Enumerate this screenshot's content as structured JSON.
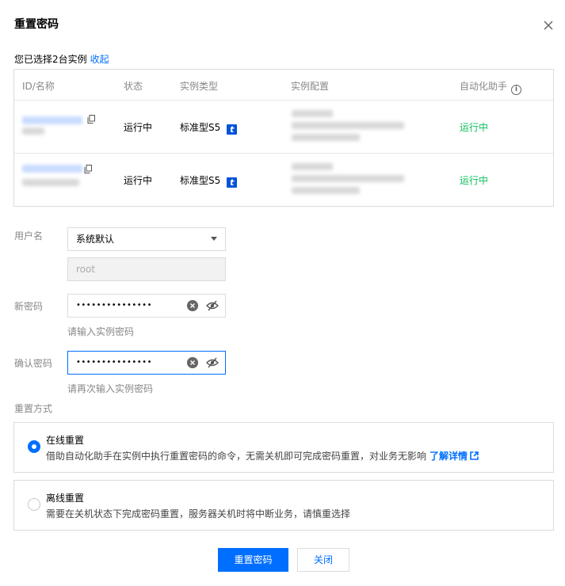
{
  "dialog": {
    "title": "重置密码",
    "close_icon": "close-icon"
  },
  "selection": {
    "text": "您已选择2台实例",
    "toggle_link": "收起"
  },
  "table": {
    "headers": [
      "ID/名称",
      "状态",
      "实例类型",
      "实例配置",
      "自动化助手"
    ],
    "rows": [
      {
        "status": "运行中",
        "type": "标准型S5",
        "type_badge": "t",
        "assistant": "运行中"
      },
      {
        "status": "运行中",
        "type": "标准型S5",
        "type_badge": "t",
        "assistant": "运行中"
      }
    ]
  },
  "form": {
    "username_label": "用户名",
    "username_select": "系统默认",
    "username_value": "root",
    "new_password_label": "新密码",
    "new_password_value": "•••••••••••••••",
    "new_password_hint": "请输入实例密码",
    "confirm_password_label": "确认密码",
    "confirm_password_value": "•••••••••••••••",
    "confirm_password_hint": "请再次输入实例密码",
    "reset_method_label": "重置方式"
  },
  "options": [
    {
      "title": "在线重置",
      "desc": "借助自动化助手在实例中执行重置密码的命令，无需关机即可完成密码重置，对业务无影响",
      "link": "了解详情",
      "selected": true
    },
    {
      "title": "离线重置",
      "desc": "需要在关机状态下完成密码重置，服务器关机时将中断业务，请慎重选择",
      "selected": false
    }
  ],
  "buttons": {
    "primary": "重置密码",
    "secondary": "关闭"
  },
  "colors": {
    "accent": "#006eff",
    "success": "#0abf5b"
  }
}
